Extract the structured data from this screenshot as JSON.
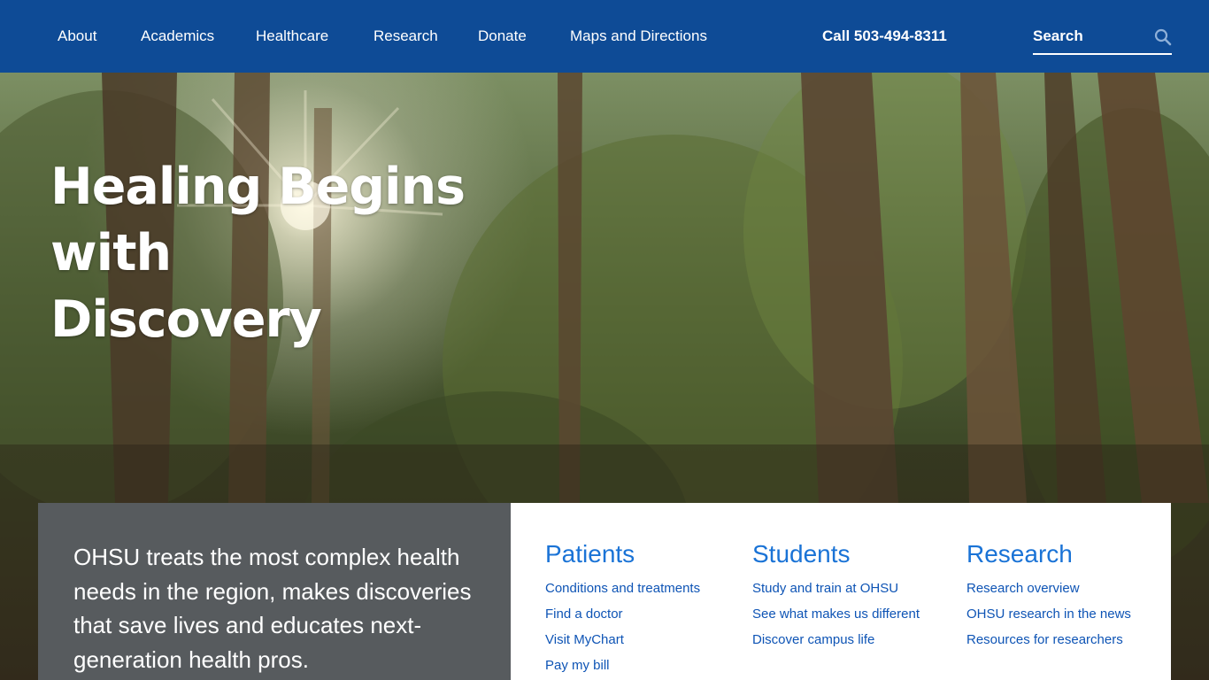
{
  "nav": {
    "items": [
      {
        "label": "About"
      },
      {
        "label": "Academics"
      },
      {
        "label": "Healthcare"
      },
      {
        "label": "Research"
      },
      {
        "label": "Donate"
      },
      {
        "label": "Maps and Directions"
      }
    ],
    "phone": "Call 503-494-8311",
    "search": {
      "placeholder": "Search",
      "icon": "search-icon"
    }
  },
  "hero": {
    "title_line1": "Healing Begins with",
    "title_line2": "Discovery"
  },
  "mission": {
    "text": "OHSU treats the most complex health needs in the region, makes discoveries that save lives and educates next-generation health pros."
  },
  "columns": [
    {
      "heading": "Patients",
      "links": [
        "Conditions and treatments",
        "Find a doctor",
        "Visit MyChart",
        "Pay my bill"
      ]
    },
    {
      "heading": "Students",
      "links": [
        "Study and train at OHSU",
        "See what makes us different",
        "Discover campus life"
      ]
    },
    {
      "heading": "Research",
      "links": [
        "Research overview",
        "OHSU research in the news",
        "Resources for researchers"
      ]
    }
  ],
  "colors": {
    "nav_background": "#0e4b96",
    "mission_background": "#575b5e",
    "link_heading": "#1a73d6",
    "link_text": "#0e54b5"
  }
}
